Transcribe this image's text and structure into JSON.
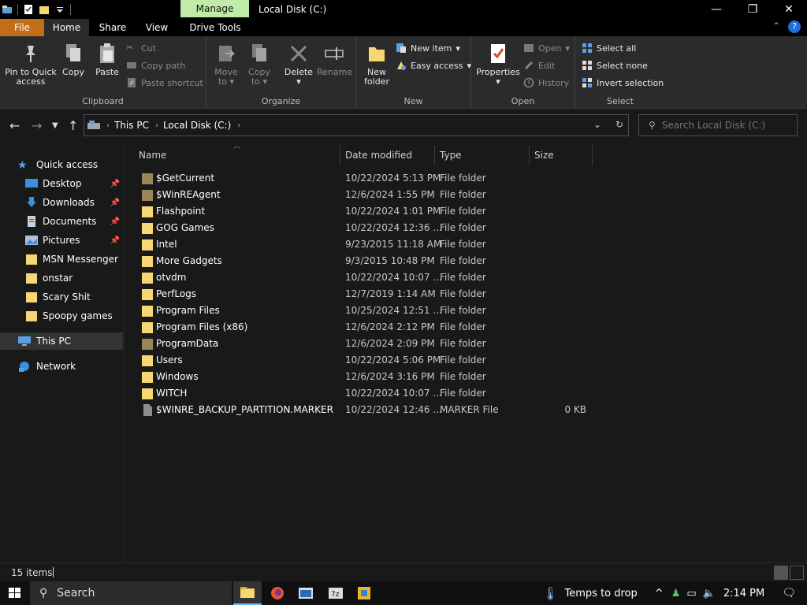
{
  "window": {
    "title": "Local Disk (C:)",
    "contextual_tab": "Manage",
    "controls": {
      "minimize": "—",
      "maximize": "❐",
      "close": "✕"
    }
  },
  "tabs": [
    {
      "label": "File"
    },
    {
      "label": "Home"
    },
    {
      "label": "Share"
    },
    {
      "label": "View"
    },
    {
      "label": "Drive Tools"
    }
  ],
  "ribbon": {
    "clipboard": {
      "label": "Clipboard",
      "pin_line1": "Pin to Quick",
      "pin_line2": "access",
      "copy": "Copy",
      "paste": "Paste",
      "cut": "Cut",
      "copy_path": "Copy path",
      "paste_shortcut": "Paste shortcut"
    },
    "organize": {
      "label": "Organize",
      "move_line1": "Move",
      "move_line2": "to",
      "copy_line1": "Copy",
      "copy_line2": "to",
      "delete": "Delete",
      "rename": "Rename"
    },
    "new": {
      "label": "New",
      "folder_line1": "New",
      "folder_line2": "folder",
      "new_item": "New item",
      "easy_access": "Easy access"
    },
    "open": {
      "label": "Open",
      "properties": "Properties",
      "open": "Open",
      "edit": "Edit",
      "history": "History"
    },
    "select": {
      "label": "Select",
      "select_all": "Select all",
      "select_none": "Select none",
      "invert": "Invert selection"
    }
  },
  "address": {
    "crumbs": [
      "This PC",
      "Local Disk (C:)"
    ],
    "search_placeholder": "Search Local Disk (C:)"
  },
  "nav": {
    "quick_access": "Quick access",
    "items": [
      {
        "label": "Desktop",
        "icon": "desktop-icon",
        "pinned": true
      },
      {
        "label": "Downloads",
        "icon": "downloads-icon",
        "pinned": true
      },
      {
        "label": "Documents",
        "icon": "documents-icon",
        "pinned": true
      },
      {
        "label": "Pictures",
        "icon": "pictures-icon",
        "pinned": true
      },
      {
        "label": "MSN Messenger",
        "icon": "folder-icon",
        "pinned": false
      },
      {
        "label": "onstar",
        "icon": "folder-icon",
        "pinned": false
      },
      {
        "label": "Scary Shit",
        "icon": "folder-icon",
        "pinned": false
      },
      {
        "label": "Spoopy games",
        "icon": "folder-icon",
        "pinned": false
      }
    ],
    "this_pc": "This PC",
    "network": "Network"
  },
  "columns": {
    "name": "Name",
    "date": "Date modified",
    "type": "Type",
    "size": "Size"
  },
  "files": [
    {
      "name": "$GetCurrent",
      "date": "10/22/2024 5:13 PM",
      "type": "File folder",
      "size": "",
      "kind": "hidden"
    },
    {
      "name": "$WinREAgent",
      "date": "12/6/2024 1:55 PM",
      "type": "File folder",
      "size": "",
      "kind": "hidden"
    },
    {
      "name": "Flashpoint",
      "date": "10/22/2024 1:01 PM",
      "type": "File folder",
      "size": "",
      "kind": "folder"
    },
    {
      "name": "GOG Games",
      "date": "10/22/2024 12:36 ...",
      "type": "File folder",
      "size": "",
      "kind": "folder"
    },
    {
      "name": "Intel",
      "date": "9/23/2015 11:18 AM",
      "type": "File folder",
      "size": "",
      "kind": "folder"
    },
    {
      "name": "More Gadgets",
      "date": "9/3/2015 10:48 PM",
      "type": "File folder",
      "size": "",
      "kind": "folder"
    },
    {
      "name": "otvdm",
      "date": "10/22/2024 10:07 ...",
      "type": "File folder",
      "size": "",
      "kind": "folder"
    },
    {
      "name": "PerfLogs",
      "date": "12/7/2019 1:14 AM",
      "type": "File folder",
      "size": "",
      "kind": "folder"
    },
    {
      "name": "Program Files",
      "date": "10/25/2024 12:51 ...",
      "type": "File folder",
      "size": "",
      "kind": "folder"
    },
    {
      "name": "Program Files (x86)",
      "date": "12/6/2024 2:12 PM",
      "type": "File folder",
      "size": "",
      "kind": "folder"
    },
    {
      "name": "ProgramData",
      "date": "12/6/2024 2:09 PM",
      "type": "File folder",
      "size": "",
      "kind": "hidden"
    },
    {
      "name": "Users",
      "date": "10/22/2024 5:06 PM",
      "type": "File folder",
      "size": "",
      "kind": "folder"
    },
    {
      "name": "Windows",
      "date": "12/6/2024 3:16 PM",
      "type": "File folder",
      "size": "",
      "kind": "folder"
    },
    {
      "name": "WITCH",
      "date": "10/22/2024 10:07 ...",
      "type": "File folder",
      "size": "",
      "kind": "folder"
    },
    {
      "name": "$WINRE_BACKUP_PARTITION.MARKER",
      "date": "10/22/2024 12:46 ...",
      "type": "MARKER File",
      "size": "0 KB",
      "kind": "file"
    }
  ],
  "status": {
    "count": "15 items"
  },
  "taskbar": {
    "search": "Search",
    "weather": "Temps to drop",
    "time": "2:14 PM"
  },
  "colors": {
    "file_tab": "#c26d17",
    "manage_tab": "#c1eba8",
    "folder": "#f7d774",
    "hidden_folder": "#9a8657",
    "accent": "#1e6fd9"
  }
}
